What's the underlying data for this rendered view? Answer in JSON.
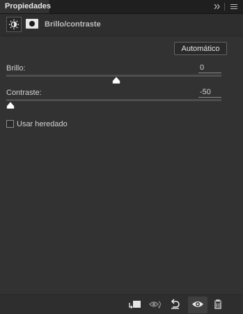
{
  "tab": {
    "label": "Propiedades"
  },
  "header": {
    "title": "Brillo/contraste"
  },
  "auto_button": {
    "label": "Automático"
  },
  "sliders": [
    {
      "label": "Brillo:",
      "value": "0",
      "position": 0.5
    },
    {
      "label": "Contraste:",
      "value": "-50",
      "position": 0.0
    }
  ],
  "legacy": {
    "label": "Usar heredado",
    "checked": false
  },
  "footer": {
    "buttons": [
      "clip-to-layer-icon",
      "view-previous-state-icon",
      "reset-icon",
      "visibility-eye-icon",
      "trash-icon"
    ]
  },
  "colors": {
    "panel": "#323232",
    "text": "#d2d2d2",
    "track": "#4e4e4e",
    "thumb": "#ffffff"
  }
}
